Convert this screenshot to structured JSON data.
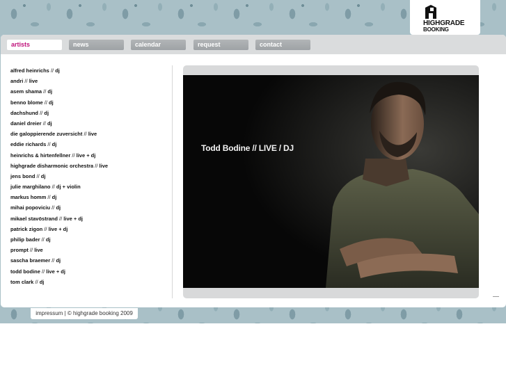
{
  "logo": {
    "line1": "HIGHGRADE",
    "line2": "BOOKING"
  },
  "nav": {
    "tabs": [
      {
        "label": "artists",
        "active": true
      },
      {
        "label": "news",
        "active": false
      },
      {
        "label": "calendar",
        "active": false
      },
      {
        "label": "request",
        "active": false
      },
      {
        "label": "contact",
        "active": false
      }
    ]
  },
  "artists": [
    {
      "name": "alfred heinrichs",
      "sep": " // ",
      "type": "dj"
    },
    {
      "name": "andri",
      "sep": " // ",
      "type": "live"
    },
    {
      "name": "asem shama",
      "sep": " // ",
      "type": "dj"
    },
    {
      "name": "benno blome",
      "sep": " // ",
      "type": "dj"
    },
    {
      "name": "dachshund",
      "sep": " // ",
      "type": "dj"
    },
    {
      "name": "daniel dreier",
      "sep": " // ",
      "type": "dj"
    },
    {
      "name": "die galoppierende zuversicht",
      "sep": " // ",
      "type": "live"
    },
    {
      "name": "eddie richards",
      "sep": " // ",
      "type": "dj"
    },
    {
      "name": "heinrichs & hirtenfellner",
      "sep": " // ",
      "type": "live + dj"
    },
    {
      "name": "highgrade disharmonic orchestra",
      "sep": " // ",
      "type": "live"
    },
    {
      "name": "jens bond",
      "sep": " // ",
      "type": "dj"
    },
    {
      "name": "julie marghilano",
      "sep": " // ",
      "type": "dj + violin"
    },
    {
      "name": "markus homm",
      "sep": " // ",
      "type": "dj"
    },
    {
      "name": "mihai popoviciu",
      "sep": " // ",
      "type": "dj"
    },
    {
      "name": "mikael stavöstrand",
      "sep": " // ",
      "type": "live + dj"
    },
    {
      "name": "patrick zigon",
      "sep": " // ",
      "type": "live + dj"
    },
    {
      "name": "philip bader",
      "sep": " // ",
      "type": "dj"
    },
    {
      "name": "prompt",
      "sep": " // ",
      "type": "live"
    },
    {
      "name": "sascha braemer",
      "sep": " // ",
      "type": "dj"
    },
    {
      "name": "todd bodine",
      "sep": " // ",
      "type": "live + dj"
    },
    {
      "name": "tom clark",
      "sep": " // ",
      "type": "dj"
    }
  ],
  "feature": {
    "caption": "Todd Bodine // LIVE / DJ"
  },
  "footer": {
    "impressum": "impressum",
    "separator": " | ",
    "copyright": "© highgrade booking 2009"
  },
  "colors": {
    "active_tab": "#c0157c",
    "background": "#a9c0c7",
    "tab_gray": "#a8abad"
  }
}
